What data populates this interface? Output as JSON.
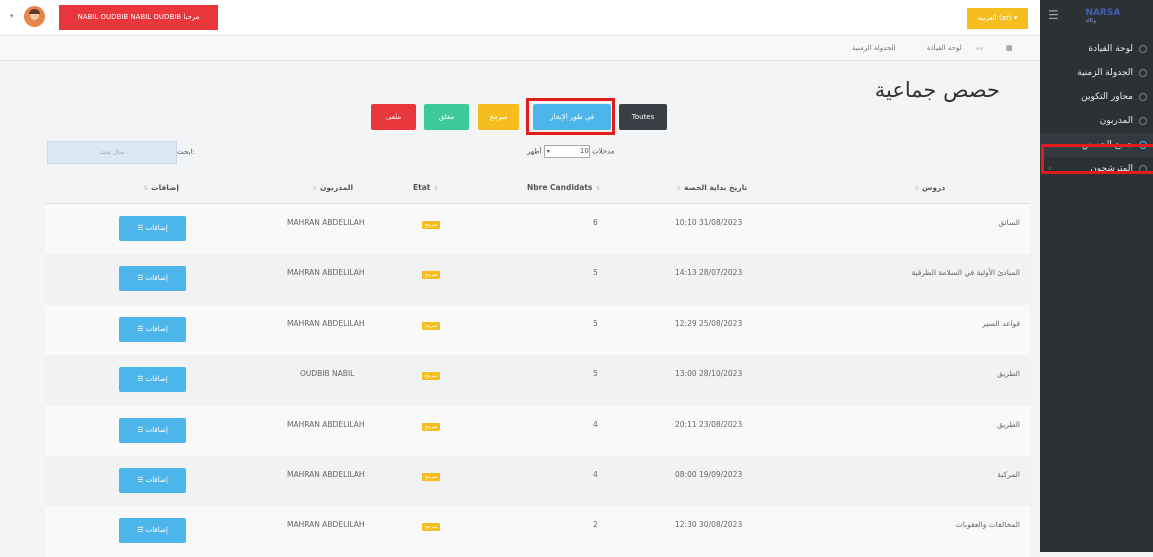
{
  "sidebar": {
    "brand": "NARSA",
    "brand_sub": "وكالة",
    "items": [
      {
        "label": "لوحة القيادة"
      },
      {
        "label": "الجدولة الزمنية"
      },
      {
        "label": "محاور التكوين"
      },
      {
        "label": "المدربون"
      },
      {
        "label": "جميع الحصص"
      },
      {
        "label": "المترشحون"
      }
    ]
  },
  "topbar": {
    "user_button": "NABIL OUDBIB NABIL OUDBIB مرحبا",
    "language_button": "العربية (ar) ▾"
  },
  "breadcrumb": {
    "dashboard": "لوحة القيادة",
    "schedule": "الجدولة الزمنية"
  },
  "page": {
    "title": "حصص جماعية"
  },
  "filters": {
    "all": "Toutes",
    "in_progress": "في طور الإنجاز",
    "scheduled": "مبرمج",
    "closed": "مغلق",
    "cancelled": "ملغى"
  },
  "controls": {
    "show_prefix": "أظهر",
    "page_size": "10",
    "show_suffix": "مدخلات",
    "search_label": "ابحث:",
    "search_placeholder": "مثال بحث"
  },
  "table": {
    "headers": {
      "course": "دروس",
      "start_date": "تاريخ بداية الحصة",
      "candidates": "Nbre Candidats",
      "state": "Etat",
      "trainers": "المدربون",
      "actions": "إضافات"
    },
    "rows": [
      {
        "course": "السائق",
        "date": "10:10 31/08/2023",
        "candidates": "6",
        "state": "مبرمج",
        "trainer": "MAHRAN ABDELILAH",
        "action": "إضافات"
      },
      {
        "course": "المبادئ الأولية في السلامة الطرقية",
        "date": "14:13 28/07/2023",
        "candidates": "5",
        "state": "مبرمج",
        "trainer": "MAHRAN ABDELILAH",
        "action": "إضافات"
      },
      {
        "course": "قواعد السير",
        "date": "12:29 25/08/2023",
        "candidates": "5",
        "state": "مبرمج",
        "trainer": "MAHRAN ABDELILAH",
        "action": "إضافات"
      },
      {
        "course": "الطريق",
        "date": "13:00 28/10/2023",
        "candidates": "5",
        "state": "مبرمج",
        "trainer": "OUDBIB NABIL",
        "action": "إضافات"
      },
      {
        "course": "الطريق",
        "date": "20:11 23/08/2023",
        "candidates": "4",
        "state": "مبرمج",
        "trainer": "MAHRAN ABDELILAH",
        "action": "إضافات"
      },
      {
        "course": "المركبة",
        "date": "08:00 19/09/2023",
        "candidates": "4",
        "state": "مبرمج",
        "trainer": "MAHRAN ABDELILAH",
        "action": "إضافات"
      },
      {
        "course": "المخالفات والعقوبات",
        "date": "12:30 30/08/2023",
        "candidates": "2",
        "state": "مبرمج",
        "trainer": "MAHRAN ABDELILAH",
        "action": "إضافات"
      }
    ]
  },
  "colors": {
    "sidebar_bg": "#2c3136",
    "danger": "#e8363b",
    "warning": "#f5bd1e",
    "info": "#4cb6ea",
    "success": "#3ec99a",
    "dark": "#3a3f45",
    "highlight": "#e21b1b"
  }
}
